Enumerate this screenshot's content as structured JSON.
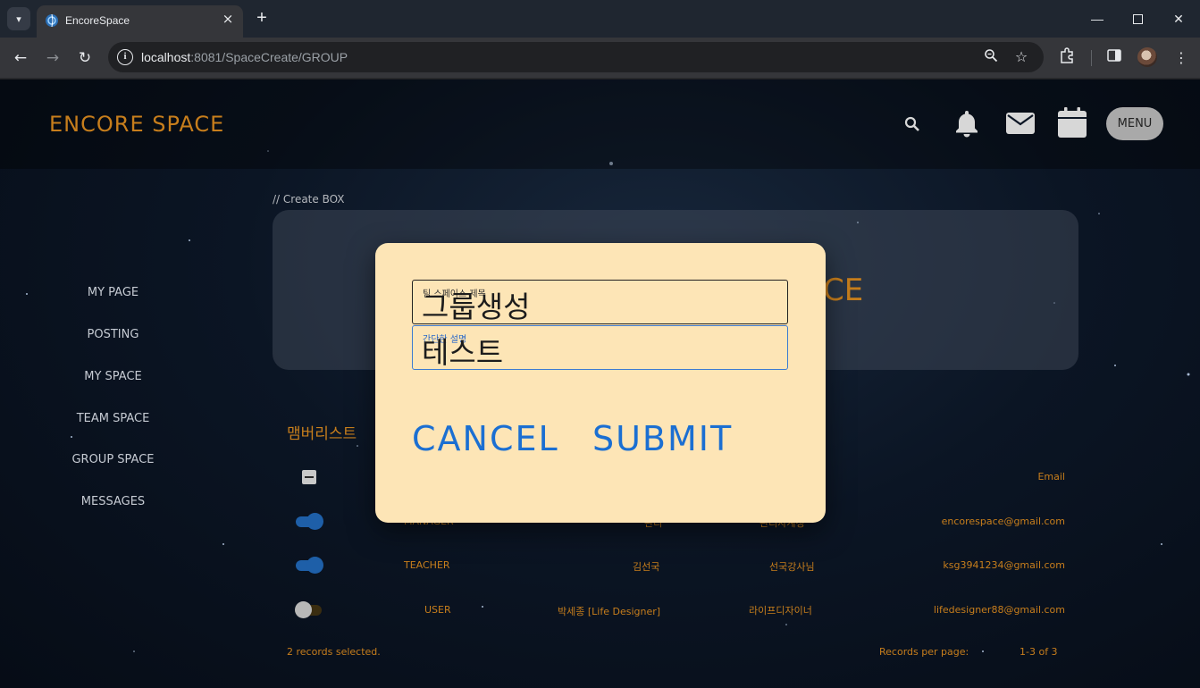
{
  "browser": {
    "tab_title": "EncoreSpace",
    "url_host": "localhost",
    "url_path": ":8081/SpaceCreate/GROUP"
  },
  "header": {
    "brand": "ENCORE SPACE",
    "menu_label": "MENU"
  },
  "sidebar": {
    "items": [
      {
        "label": "MY PAGE"
      },
      {
        "label": "POSTING"
      },
      {
        "label": "MY SPACE"
      },
      {
        "label": "TEAM SPACE"
      },
      {
        "label": "GROUP SPACE"
      },
      {
        "label": "MESSAGES"
      }
    ]
  },
  "main": {
    "breadcrumb": "// Create BOX",
    "create_title_fragment": "CE",
    "members_title": "맴버리스트",
    "email_header": "Email",
    "rows": [
      {
        "role": "MANAGER",
        "name": "관리",
        "nickname": "관리자계정",
        "email": "encorespace@gmail.com",
        "enabled": true
      },
      {
        "role": "TEACHER",
        "name": "김선국",
        "nickname": "선국강사님",
        "email": "ksg3941234@gmail.com",
        "enabled": true
      },
      {
        "role": "USER",
        "name": "박세종 [Life Designer]",
        "nickname": "라이프디자이너",
        "email": "lifedesigner88@gmail.com",
        "enabled": false
      }
    ],
    "selected_text": "2 records selected.",
    "per_page_label": "Records per page:",
    "pagination": "1-3 of 3"
  },
  "dialog": {
    "title_field_label": "팀 스페이스 제목",
    "title_field_value": "그룹생성",
    "desc_field_label": "간단한 설명",
    "desc_field_value": "테스트",
    "cancel_label": "CANCEL",
    "submit_label": "SUBMIT"
  },
  "colors": {
    "accent_orange": "#c77e1c",
    "dialog_bg": "#fde5b6",
    "dialog_button_blue": "#1b6fd2",
    "toggle_on": "#1e5fa8"
  }
}
